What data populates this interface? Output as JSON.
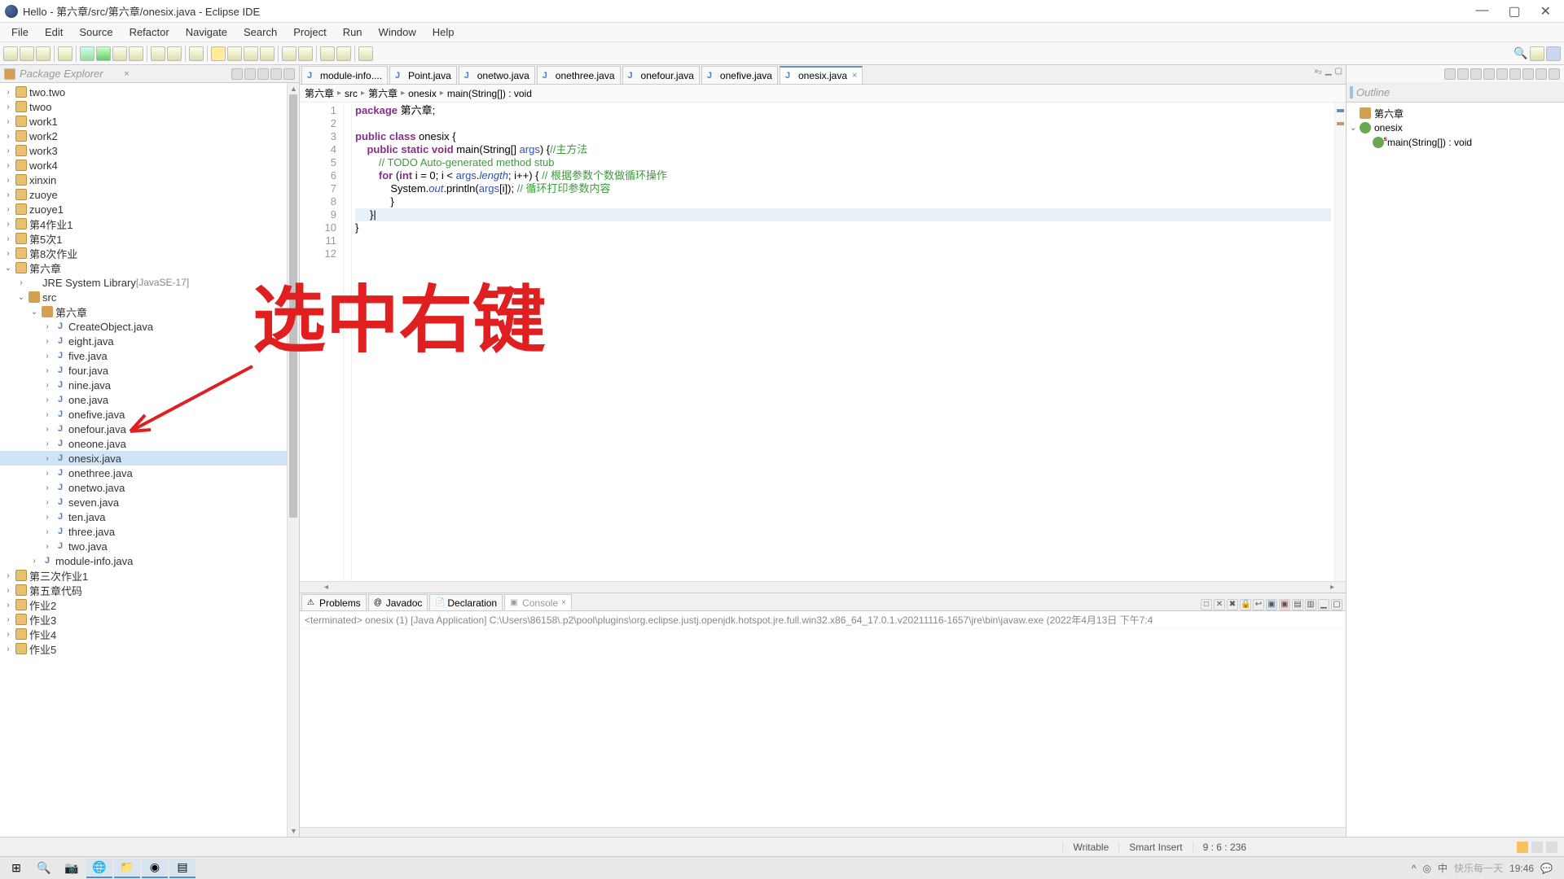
{
  "window": {
    "title": "Hello - 第六章/src/第六章/onesix.java - Eclipse IDE"
  },
  "menu": [
    "File",
    "Edit",
    "Source",
    "Refactor",
    "Navigate",
    "Search",
    "Project",
    "Run",
    "Window",
    "Help"
  ],
  "explorer": {
    "header": "Package Explorer",
    "tree": [
      {
        "d": 0,
        "chev": "›",
        "icon": "folder",
        "label": "two.two"
      },
      {
        "d": 0,
        "chev": "›",
        "icon": "folder",
        "label": "twoo"
      },
      {
        "d": 0,
        "chev": "›",
        "icon": "folder",
        "label": "work1"
      },
      {
        "d": 0,
        "chev": "›",
        "icon": "folder",
        "label": "work2"
      },
      {
        "d": 0,
        "chev": "›",
        "icon": "folder",
        "label": "work3"
      },
      {
        "d": 0,
        "chev": "›",
        "icon": "folder",
        "label": "work4"
      },
      {
        "d": 0,
        "chev": "›",
        "icon": "folder",
        "label": "xinxin"
      },
      {
        "d": 0,
        "chev": "›",
        "icon": "folder",
        "label": "zuoye"
      },
      {
        "d": 0,
        "chev": "›",
        "icon": "folder",
        "label": "zuoye1"
      },
      {
        "d": 0,
        "chev": "›",
        "icon": "folder",
        "label": "第4作业1"
      },
      {
        "d": 0,
        "chev": "›",
        "icon": "folder",
        "label": "第5次1"
      },
      {
        "d": 0,
        "chev": "›",
        "icon": "folder",
        "label": "第8次作业"
      },
      {
        "d": 0,
        "chev": "⌄",
        "icon": "folder",
        "label": "第六章"
      },
      {
        "d": 1,
        "chev": "›",
        "icon": "lib",
        "label": "JRE System Library",
        "suffix": " [JavaSE-17]"
      },
      {
        "d": 1,
        "chev": "⌄",
        "icon": "pkg",
        "label": "src"
      },
      {
        "d": 2,
        "chev": "⌄",
        "icon": "pkg",
        "label": "第六章"
      },
      {
        "d": 3,
        "chev": "›",
        "icon": "jfile",
        "label": "CreateObject.java"
      },
      {
        "d": 3,
        "chev": "›",
        "icon": "jfile",
        "label": "eight.java"
      },
      {
        "d": 3,
        "chev": "›",
        "icon": "jfile",
        "label": "five.java"
      },
      {
        "d": 3,
        "chev": "›",
        "icon": "jfile",
        "label": "four.java"
      },
      {
        "d": 3,
        "chev": "›",
        "icon": "jfile",
        "label": "nine.java"
      },
      {
        "d": 3,
        "chev": "›",
        "icon": "jfile",
        "label": "one.java"
      },
      {
        "d": 3,
        "chev": "›",
        "icon": "jfile",
        "label": "onefive.java"
      },
      {
        "d": 3,
        "chev": "›",
        "icon": "jfile",
        "label": "onefour.java"
      },
      {
        "d": 3,
        "chev": "›",
        "icon": "jfile",
        "label": "oneone.java"
      },
      {
        "d": 3,
        "chev": "›",
        "icon": "jfile",
        "label": "onesix.java",
        "sel": true
      },
      {
        "d": 3,
        "chev": "›",
        "icon": "jfile",
        "label": "onethree.java"
      },
      {
        "d": 3,
        "chev": "›",
        "icon": "jfile",
        "label": "onetwo.java"
      },
      {
        "d": 3,
        "chev": "›",
        "icon": "jfile",
        "label": "seven.java"
      },
      {
        "d": 3,
        "chev": "›",
        "icon": "jfile",
        "label": "ten.java"
      },
      {
        "d": 3,
        "chev": "›",
        "icon": "jfile",
        "label": "three.java"
      },
      {
        "d": 3,
        "chev": "›",
        "icon": "jfile",
        "label": "two.java"
      },
      {
        "d": 2,
        "chev": "›",
        "icon": "jfile",
        "label": "module-info.java"
      },
      {
        "d": 0,
        "chev": "›",
        "icon": "folder",
        "label": "第三次作业1"
      },
      {
        "d": 0,
        "chev": "›",
        "icon": "folder",
        "label": "第五章代码"
      },
      {
        "d": 0,
        "chev": "›",
        "icon": "folder",
        "label": "作业2"
      },
      {
        "d": 0,
        "chev": "›",
        "icon": "folder",
        "label": "作业3"
      },
      {
        "d": 0,
        "chev": "›",
        "icon": "folder",
        "label": "作业4"
      },
      {
        "d": 0,
        "chev": "›",
        "icon": "folder",
        "label": "作业5"
      }
    ]
  },
  "tabs": [
    {
      "label": "module-info...."
    },
    {
      "label": "Point.java"
    },
    {
      "label": "onetwo.java"
    },
    {
      "label": "onethree.java"
    },
    {
      "label": "onefour.java"
    },
    {
      "label": "onefive.java"
    },
    {
      "label": "onesix.java",
      "active": true
    }
  ],
  "breadcrumb": [
    "第六章",
    "src",
    "第六章",
    "onesix",
    "main(String[]) : void"
  ],
  "code": {
    "lines": [
      {
        "n": 1,
        "html": "<span class='kw'>package</span> 第六章;"
      },
      {
        "n": 2,
        "html": ""
      },
      {
        "n": 3,
        "html": "<span class='kw'>public class</span> onesix {"
      },
      {
        "n": 4,
        "html": "    <span class='kw'>public static void</span> main(String[] <span class='str'>args</span>) {<span class='com'>//主方法</span>",
        "hl": false,
        "marker": true
      },
      {
        "n": 5,
        "html": "        <span class='com'>// TODO Auto-generated method stub</span>"
      },
      {
        "n": 6,
        "html": "        <span class='kw'>for</span> (<span class='kw'>int</span> i = 0; i &lt; <span class='str'>args</span>.<span class='it'>length</span>; i++) { <span class='com'>// 根据参数个数做循环操作</span>"
      },
      {
        "n": 7,
        "html": "            System.<span class='it'>out</span>.println(<span class='str'>args</span>[i]); <span class='com'>// 循环打印参数内容</span>"
      },
      {
        "n": 8,
        "html": "            }"
      },
      {
        "n": 9,
        "html": "     }|",
        "hl": true
      },
      {
        "n": 10,
        "html": "}"
      },
      {
        "n": 11,
        "html": ""
      },
      {
        "n": 12,
        "html": ""
      }
    ]
  },
  "bottomTabs": [
    {
      "label": "Problems",
      "icon": "⚠"
    },
    {
      "label": "Javadoc",
      "icon": "@"
    },
    {
      "label": "Declaration",
      "icon": "📄"
    },
    {
      "label": "Console",
      "icon": "▣",
      "active": true
    }
  ],
  "console": {
    "line": "<terminated> onesix (1) [Java Application] C:\\Users\\86158\\.p2\\pool\\plugins\\org.eclipse.justj.openjdk.hotspot.jre.full.win32.x86_64_17.0.1.v20211116-1657\\jre\\bin\\javaw.exe  (2022年4月13日 下午7:4"
  },
  "outline": {
    "header": "Outline",
    "items": [
      {
        "d": 0,
        "icon": "pkg",
        "label": "第六章"
      },
      {
        "d": 0,
        "icon": "class",
        "label": "onesix",
        "chev": "⌄"
      },
      {
        "d": 1,
        "icon": "method",
        "label": "main(String[]) : void"
      }
    ]
  },
  "status": {
    "writable": "Writable",
    "insert": "Smart Insert",
    "pos": "9 : 6 : 236"
  },
  "taskbar": {
    "time": "19:46",
    "watermark": "快乐每一天"
  },
  "annotation": {
    "text": "选中右键"
  }
}
